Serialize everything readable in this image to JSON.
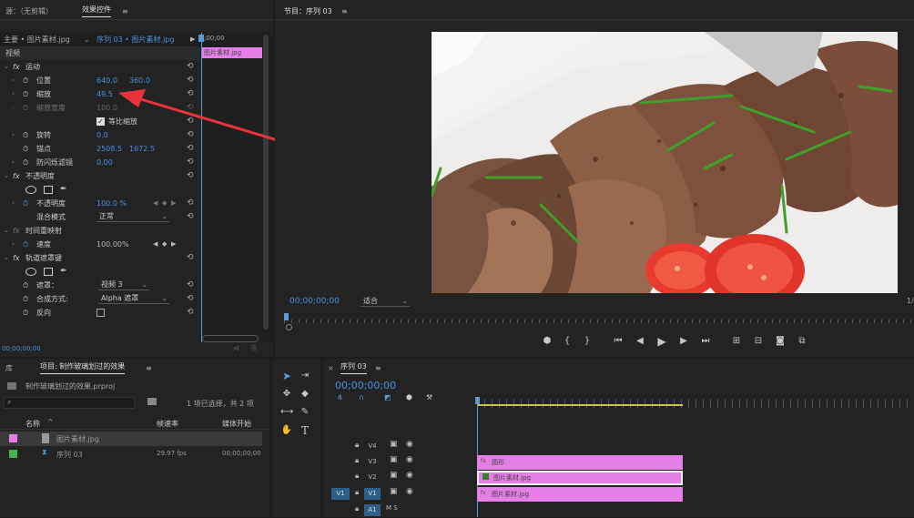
{
  "colors": {
    "accent_blue": "#4a90e2",
    "clip_pink": "#e57ee6",
    "arrow_red": "#e8333b",
    "label_green": "#3fb34f",
    "playhead": "#5b9bd5"
  },
  "source_panel": {
    "title": "源：（无剪辑）",
    "tab_label": "效果控件",
    "menu_icon": "menu-icon"
  },
  "effect_controls": {
    "master_label": "主要 • 图片素材.jpg",
    "sequence_label": "序列 03 • 图片素材.jpg",
    "mini_timecode": ";00;00",
    "mini_clip_label": "图片素材.jpg",
    "video_header": "视频",
    "motion": "运动",
    "position_label": "位置",
    "position_x": "640.0",
    "position_y": "360.0",
    "scale_label": "缩放",
    "scale_value": "49.5",
    "scale_width_label": "缩放宽度",
    "scale_width_value": "100.0",
    "uniform_scale_label": "等比缩放",
    "rotation_label": "旋转",
    "rotation_value": "0.0",
    "anchor_label": "锚点",
    "anchor_x": "2508.5",
    "anchor_y": "1672.5",
    "antiflicker_label": "防闪烁滤镜",
    "antiflicker_value": "0.00",
    "opacity_header": "不透明度",
    "opacity_label": "不透明度",
    "opacity_value": "100.0 %",
    "blend_label": "混合模式",
    "blend_value": "正常",
    "time_remap_header": "时间重映射",
    "speed_label": "速度",
    "speed_value": "100.00%",
    "track_matte_header": "轨道遮罩键",
    "matte_label": "遮罩：",
    "matte_value": "视频 3",
    "composite_label": "合成方式:",
    "composite_value": "Alpha 遮罩",
    "reverse_label": "反向",
    "bottom_timecode": "00;00;00;00"
  },
  "program_monitor": {
    "title": "节目：序列 03",
    "timecode": "00;00;00;00",
    "fit_value": "适合",
    "fraction": "1/"
  },
  "project_panel": {
    "lib_tab": "库",
    "tab_label": "项目: 制作玻璃划过的效果",
    "project_file": "制作玻璃划过的效果.prproj",
    "selection_info": "1 项已选择，共 2 项",
    "col_name": "名称",
    "col_fps": "帧速率",
    "col_start": "媒体开始",
    "items": [
      {
        "name": "图片素材.jpg",
        "fps": "",
        "start": "",
        "color": "#e57ee6"
      },
      {
        "name": "序列 03",
        "fps": "29.97 fps",
        "start": "00;00;00;00",
        "color": "#3fb34f"
      }
    ]
  },
  "timeline": {
    "tab_label": "序列 03",
    "timecode": "00;00;00;00",
    "tracks": [
      {
        "name": "V4",
        "clip": ""
      },
      {
        "name": "V3",
        "clip": "圆形"
      },
      {
        "name": "V2",
        "clip": "图片素材.jpg"
      },
      {
        "name": "V1",
        "clip": "图片素材.jpg"
      },
      {
        "name": "A1",
        "clip": ""
      }
    ],
    "v1_source": "V1",
    "a1_label": "M S"
  }
}
